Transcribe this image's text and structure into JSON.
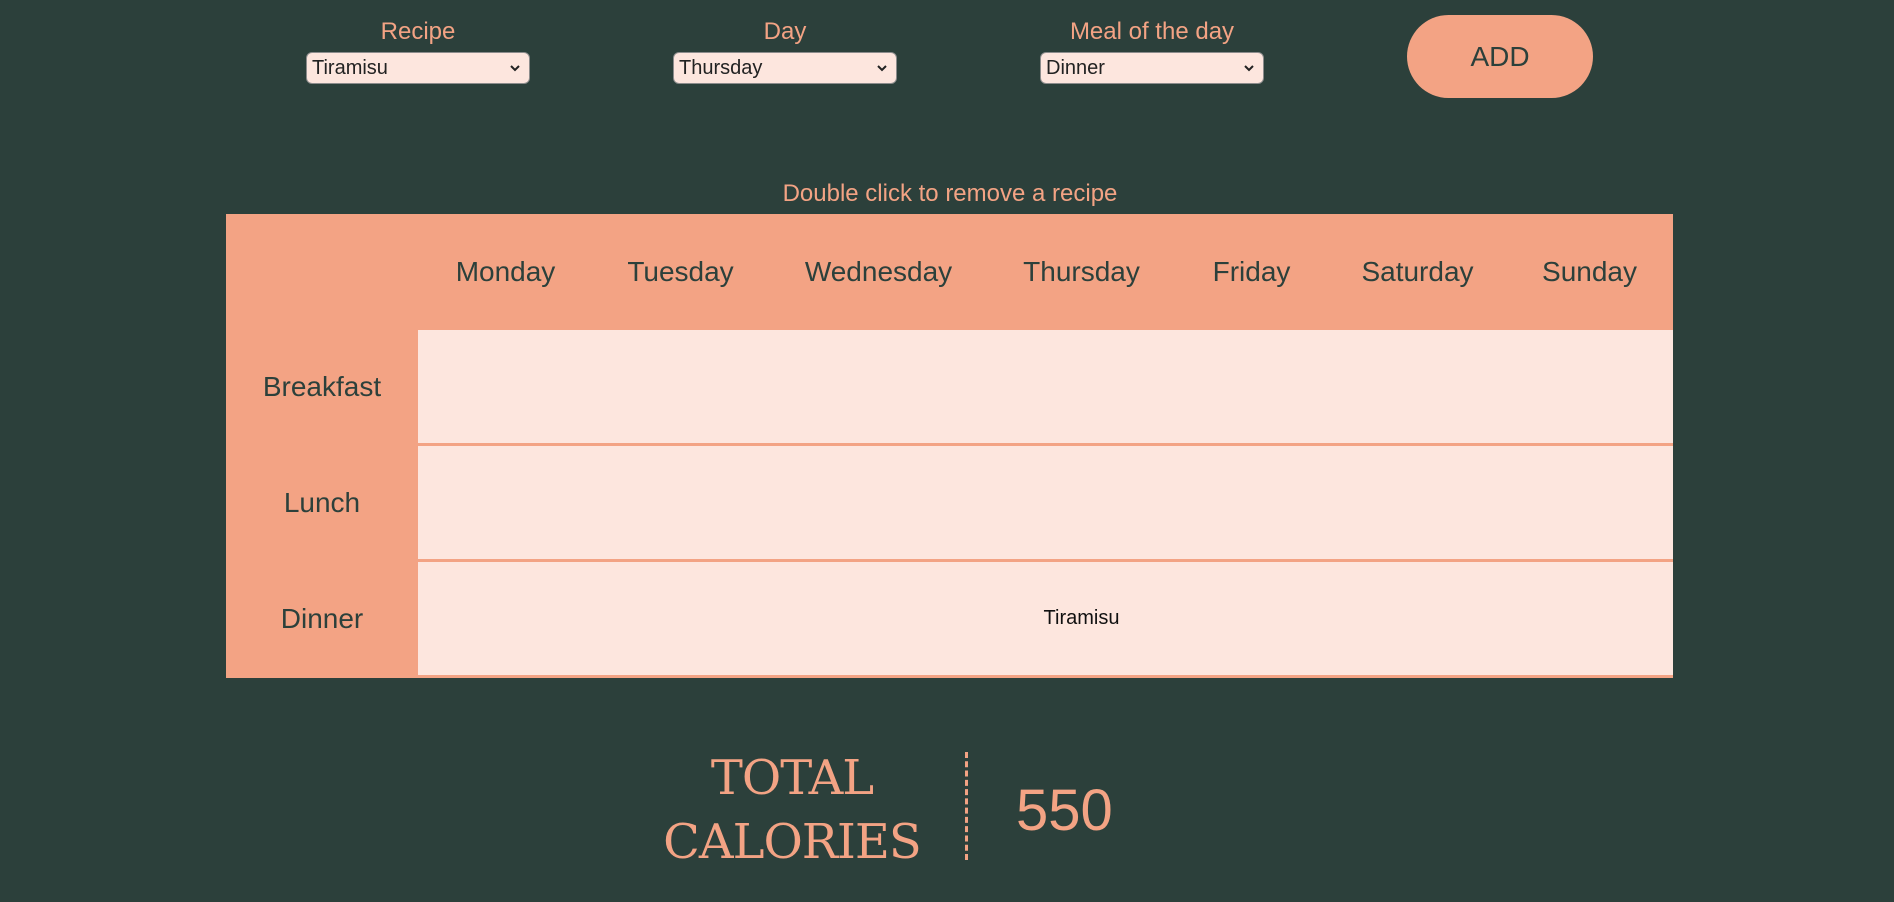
{
  "form": {
    "recipe": {
      "label": "Recipe",
      "value": "Tiramisu"
    },
    "day": {
      "label": "Day",
      "value": "Thursday"
    },
    "meal": {
      "label": "Meal of the day",
      "value": "Dinner"
    },
    "add_label": "ADD"
  },
  "hint": "Double click to remove a recipe",
  "planner": {
    "days": [
      "Monday",
      "Tuesday",
      "Wednesday",
      "Thursday",
      "Friday",
      "Saturday",
      "Sunday"
    ],
    "meals": [
      "Breakfast",
      "Lunch",
      "Dinner"
    ],
    "entries": {
      "dinner_thursday": "Tiramisu"
    }
  },
  "totals": {
    "label_line1": "TOTAL",
    "label_line2": "CALORIES",
    "value": "550"
  },
  "colors": {
    "background": "#2c403b",
    "accent": "#f3a384",
    "cell": "#fde6de"
  },
  "icons": {
    "select_arrow": "chevron-down-icon"
  }
}
